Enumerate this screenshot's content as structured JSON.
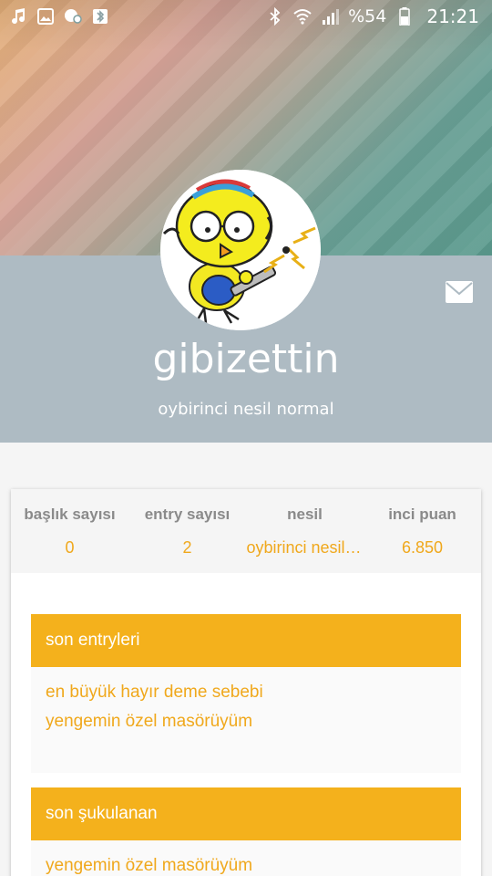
{
  "status_bar": {
    "battery_text": "%54",
    "time": "21:21",
    "icons_left": [
      "music-icon",
      "image-icon",
      "chat-icon",
      "bluetooth-icon"
    ],
    "icons_right": [
      "bluetooth-icon",
      "wifi-icon",
      "signal-icon",
      "battery-icon"
    ]
  },
  "profile": {
    "username": "gibizettin",
    "generation": "oybirinci nesil normal"
  },
  "stats": {
    "items": [
      {
        "label": "başlık sayısı",
        "value": "0"
      },
      {
        "label": "entry sayısı",
        "value": "2"
      },
      {
        "label": "nesil",
        "value": "oybirinci nesil normal"
      },
      {
        "label": "inci puan",
        "value": "6.850"
      }
    ]
  },
  "sections": {
    "recent_entries": {
      "title": "son entryleri",
      "items": [
        "en büyük hayır deme sebebi",
        "yengemin özel masörüyüm"
      ]
    },
    "recent_likes": {
      "title": "son şukulanan",
      "items": [
        "yengemin özel masörüyüm"
      ]
    }
  },
  "colors": {
    "accent": "#f4b11c",
    "profile_band": "#aebbc3",
    "link": "#f0a81c"
  }
}
